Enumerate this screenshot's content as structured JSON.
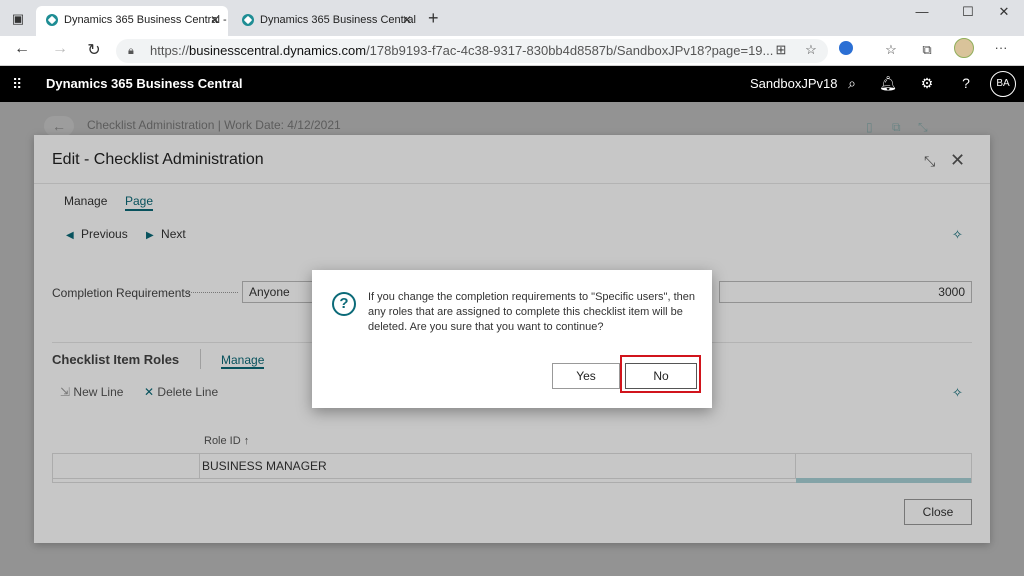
{
  "browser": {
    "tabs": [
      {
        "title": "Dynamics 365 Business Central -",
        "active": true
      },
      {
        "title": "Dynamics 365 Business Central",
        "active": false
      }
    ],
    "url_prefix": "https://",
    "url_host": "businesscentral.dynamics.com",
    "url_path": "/178b9193-f7ac-4c38-9317-830bb4d8587b/SandboxJPv18?page=19...",
    "icons": [
      "tab-menu-icon",
      "close-icon",
      "new-tab-icon",
      "minimize-icon",
      "maximize-icon",
      "window-close-icon",
      "back-icon",
      "forward-icon",
      "refresh-icon",
      "lock-icon",
      "reader-icon",
      "favorite-icon",
      "edge-icon",
      "favorites-icon",
      "collections-icon",
      "profile-icon",
      "more-icon"
    ]
  },
  "appbar": {
    "title": "Dynamics 365 Business Central",
    "environment": "SandboxJPv18",
    "user_initials": "BA"
  },
  "background": {
    "breadcrumb": "Checklist Administration | Work Date: 4/12/2021"
  },
  "card": {
    "title": "Edit - Checklist Administration",
    "menu": [
      "Manage",
      "Page"
    ],
    "actions": {
      "previous": "Previous",
      "next": "Next"
    },
    "field_label": "Completion Requirements",
    "field_value": "Anyone",
    "number_value": "3000",
    "section_title": "Checklist Item Roles",
    "section_manage": "Manage",
    "sub_actions": {
      "new_line": "New Line",
      "delete_line": "Delete Line"
    },
    "column_header": "Role ID ↑",
    "rows": [
      "BUSINESS MANAGER"
    ],
    "close_label": "Close"
  },
  "dialog": {
    "message": "If you change the completion requirements to \"Specific users\", then any roles that are assigned to complete this checklist item will be deleted. Are you sure that you want to continue?",
    "yes_label": "Yes",
    "no_label": "No",
    "accent_color": "#0b6a78",
    "highlight_color": "#d1141c"
  }
}
